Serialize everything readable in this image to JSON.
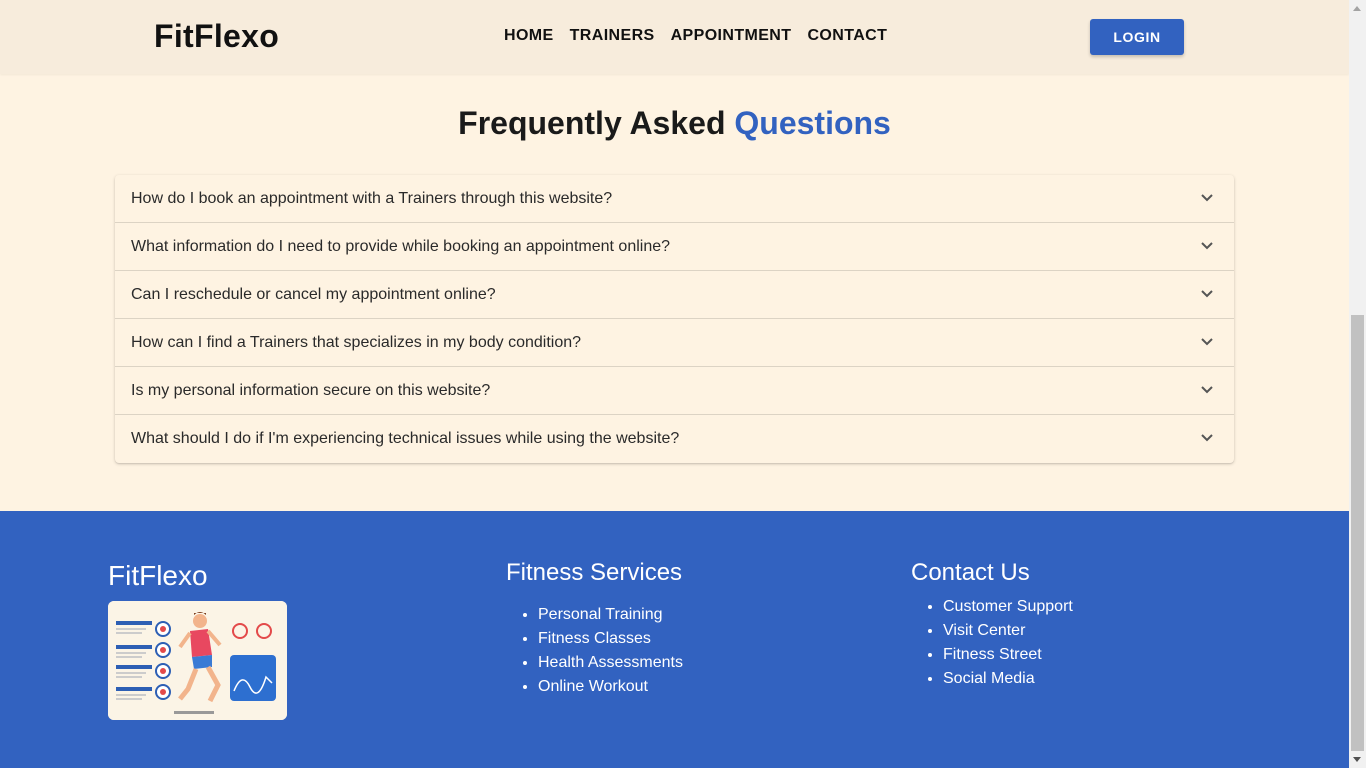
{
  "header": {
    "logo": "FitFlexo",
    "nav": [
      "HOME",
      "TRAINERS",
      "APPOINTMENT",
      "CONTACT"
    ],
    "login_label": "LOGIN"
  },
  "faq": {
    "title_prefix": "Frequently Asked",
    "title_accent": "Questions",
    "questions": [
      "How do I book an appointment with a Trainers through this website?",
      "What information do I need to provide while booking an appointment online?",
      "Can I reschedule or cancel my appointment online?",
      "How can I find a Trainers that specializes in my body condition?",
      "Is my personal information secure on this website?",
      "What should I do if I'm experiencing technical issues while using the website?"
    ]
  },
  "footer": {
    "brand": "FitFlexo",
    "image_icon": "fitness-infographic-image",
    "services_heading": "Fitness Services",
    "services": [
      "Personal Training",
      "Fitness Classes",
      "Health Assessments",
      "Online Workout"
    ],
    "contact_heading": "Contact Us",
    "contact": [
      "Customer Support",
      "Visit Center",
      "Fitness Street",
      "Social Media"
    ]
  },
  "colors": {
    "accent": "#3262c0",
    "header_bg": "#f7ecdc",
    "page_bg": "#fef3e2"
  }
}
